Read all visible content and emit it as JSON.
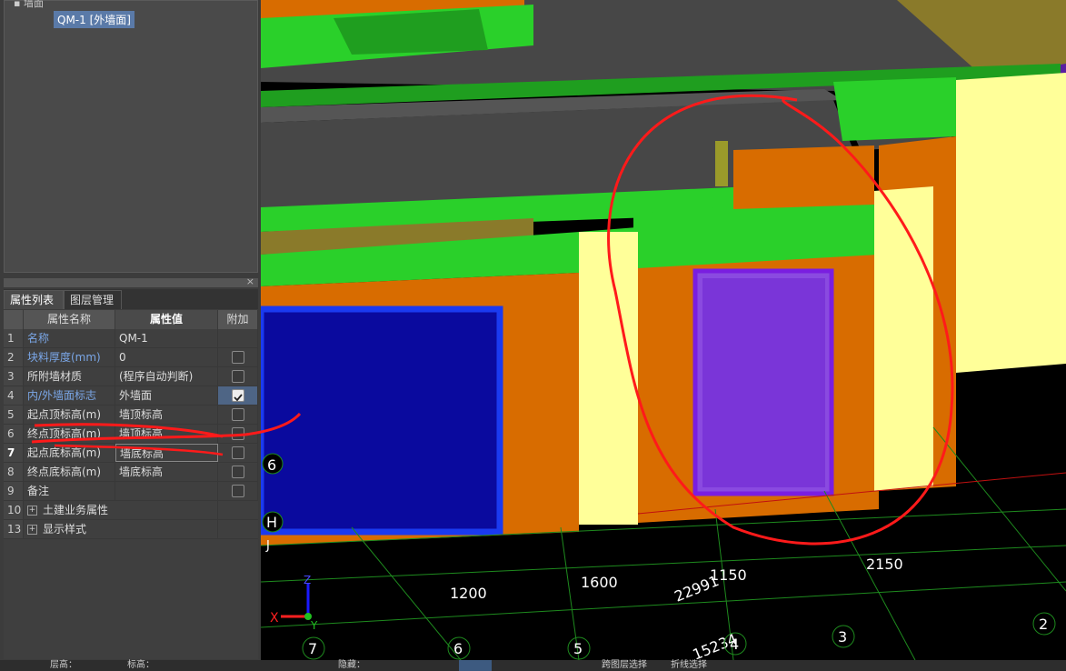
{
  "tree": {
    "parent_label": "墙面",
    "selected_node": "QM-1 [外墙面]"
  },
  "panel": {
    "close_label": "×",
    "tabs": [
      {
        "label": "属性列表"
      },
      {
        "label": "图层管理"
      }
    ],
    "headers": {
      "num": "",
      "name": "属性名称",
      "value": "属性值",
      "extra": "附加"
    },
    "rows": [
      {
        "num": "1",
        "name": "名称",
        "value": "QM-1"
      },
      {
        "num": "2",
        "name": "块料厚度(mm)",
        "value": "0"
      },
      {
        "num": "3",
        "name": "所附墙材质",
        "value": "(程序自动判断)"
      },
      {
        "num": "4",
        "name": "内/外墙面标志",
        "value": "外墙面"
      },
      {
        "num": "5",
        "name": "起点顶标高(m)",
        "value": "墙顶标高"
      },
      {
        "num": "6",
        "name": "终点顶标高(m)",
        "value": "墙顶标高"
      },
      {
        "num": "7",
        "name": "起点底标高(m)",
        "value": "墙底标高"
      },
      {
        "num": "8",
        "name": "终点底标高(m)",
        "value": "墙底标高"
      },
      {
        "num": "9",
        "name": "备注",
        "value": ""
      },
      {
        "num": "10",
        "name": "土建业务属性",
        "value": ""
      },
      {
        "num": "13",
        "name": "显示样式",
        "value": ""
      }
    ],
    "checked_row": "4"
  },
  "viewport": {
    "dimensions": [
      "1200",
      "1600",
      "1150",
      "2150",
      "22991",
      "15234"
    ],
    "axis_labels": [
      "7",
      "6",
      "5",
      "4",
      "3",
      "2",
      "6",
      "H",
      "J"
    ],
    "triad": {
      "x": "X",
      "z": "Z",
      "y": "Y"
    }
  },
  "statusbar": {
    "items": [
      "层高：",
      "标高：",
      "隐藏：",
      "跨图层选择",
      "折线选择"
    ]
  },
  "colors": {
    "wall_orange": "#d86c00",
    "slab_green": "#2ad02a",
    "column_yellow": "#ffff99",
    "window_blue": "#1010a0",
    "annotation_red": "#ff1a1a"
  }
}
